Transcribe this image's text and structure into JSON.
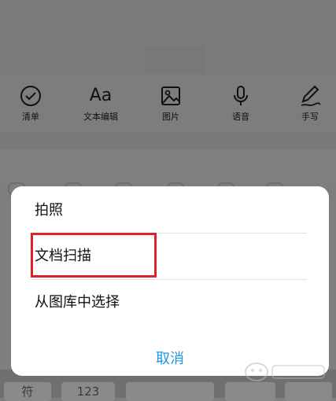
{
  "toolbar": {
    "items": [
      {
        "label": "清单",
        "icon": "checklist-icon"
      },
      {
        "label": "文本编辑",
        "icon": "text-edit-icon",
        "glyph": "Aa"
      },
      {
        "label": "图片",
        "icon": "image-icon"
      },
      {
        "label": "语音",
        "icon": "microphone-icon"
      },
      {
        "label": "手写",
        "icon": "handwriting-icon"
      }
    ]
  },
  "sheet": {
    "options": [
      "拍照",
      "文档扫描",
      "从图库中选择"
    ],
    "cancel": "取消"
  },
  "keyboard": {
    "keys": [
      "符",
      "123"
    ]
  },
  "colors": {
    "accent": "#1a96e8",
    "highlight": "#e0202a",
    "overlay": "#7e7e7e"
  }
}
